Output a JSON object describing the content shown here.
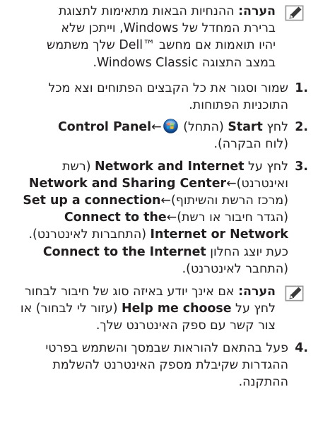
{
  "note_label": "הערה:",
  "note1": {
    "line1": "ההנחיות הבאות מתאימות לתצוגת",
    "line2a": "ברירת המחדל של ",
    "line2b": "Windows",
    "line2c": ", וייתכן שלא",
    "line3a": "יהיו תואמות אם מחשב ",
    "line3b": "Dell™",
    "line3c": " שלך משתמש",
    "line4a": "במצב התצוגה ",
    "line4b": "Windows Classic",
    "line4c": "."
  },
  "steps": {
    "s1": {
      "num": "1.",
      "text": "שמור וסגור את כל הקבצים הפתוחים וצא מכל התוכניות הפתוחות."
    },
    "s2": {
      "num": "2.",
      "t1": "לחץ ",
      "start": "Start",
      "t2": " (התחל) ",
      "arrow": "←",
      "control_panel": "Control Panel",
      "t3": "(לוח הבקרה)."
    },
    "s3": {
      "num": "3.",
      "t1": "לחץ על ",
      "network_internet": "Network and Internet",
      "t2": " (רשת ואינטרנט)",
      "arrow": "←",
      "nsc": "Network and Sharing Center",
      "t3": " (מרכז הרשת והשיתוף)",
      "setup": "Set up a connection",
      "t4": " (הגדר חיבור או רשת)",
      "connect_net": "Connect to the Internet or Network",
      "t5": " (התחברות לאינטרנט).",
      "t6": "כעת יוצג החלון ",
      "connect": "Connect to the Internet",
      "t7": " (התחבר לאינטרנט)."
    },
    "s4": {
      "num": "4.",
      "text": "פעל בהתאם להוראות שבמסך והשתמש בפרטי ההגדרות שקיבלת מספק האינטרנט להשלמת ההתקנה."
    }
  },
  "note2": {
    "t1": "אם אינך יודע באיזה סוג של חיבור לבחור לחץ על ",
    "help": "Help me choose",
    "t2": " (עזור לי לבחור) או צור קשר עם ספק האינטרנט שלך."
  },
  "icons": {
    "note": "pencil-note-icon",
    "start": "windows-start-orb-icon"
  }
}
